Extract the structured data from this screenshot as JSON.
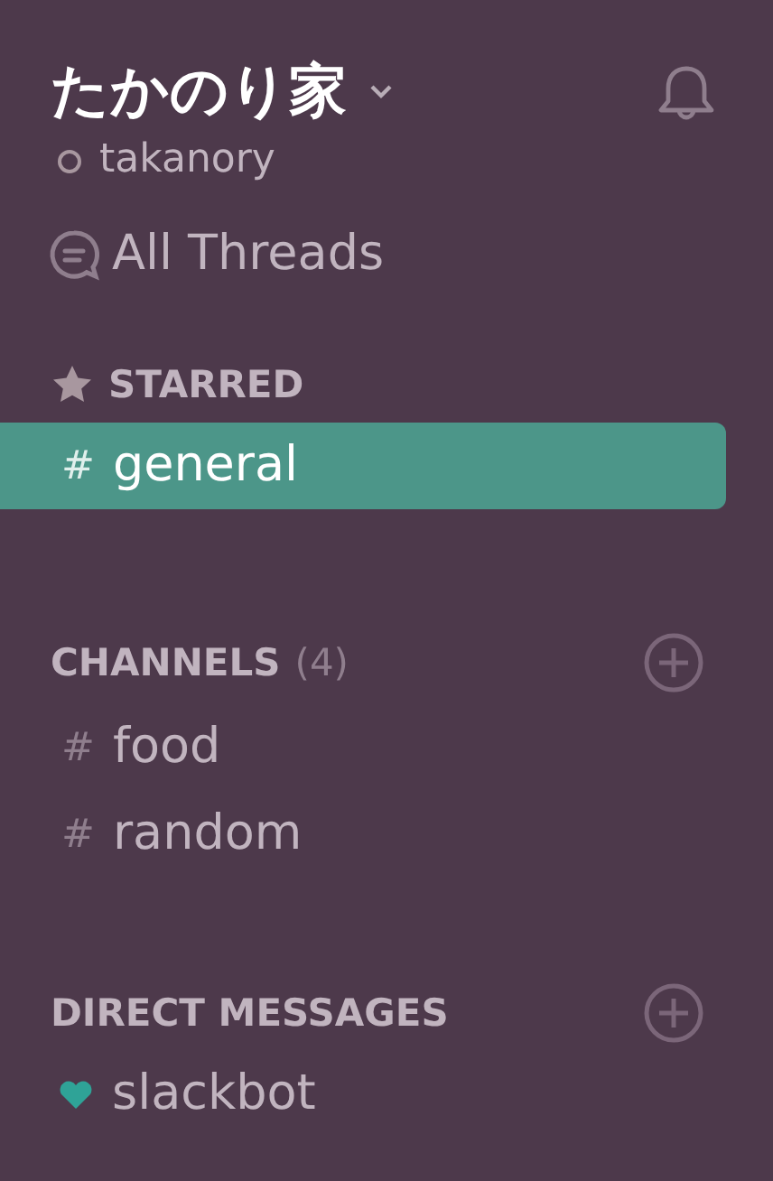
{
  "team": {
    "name": "たかのり家"
  },
  "user": {
    "name": "takanory",
    "online": false
  },
  "all_threads": {
    "label": "All Threads"
  },
  "starred": {
    "title": "STARRED",
    "channels": [
      {
        "prefix": "#",
        "name": "general",
        "selected": true
      }
    ]
  },
  "channels": {
    "title": "CHANNELS",
    "count": "(4)",
    "items": [
      {
        "prefix": "#",
        "name": "food",
        "selected": false
      },
      {
        "prefix": "#",
        "name": "random",
        "selected": false
      }
    ]
  },
  "direct_messages": {
    "title": "DIRECT MESSAGES",
    "items": [
      {
        "name": "slackbot",
        "selected": false
      }
    ]
  }
}
